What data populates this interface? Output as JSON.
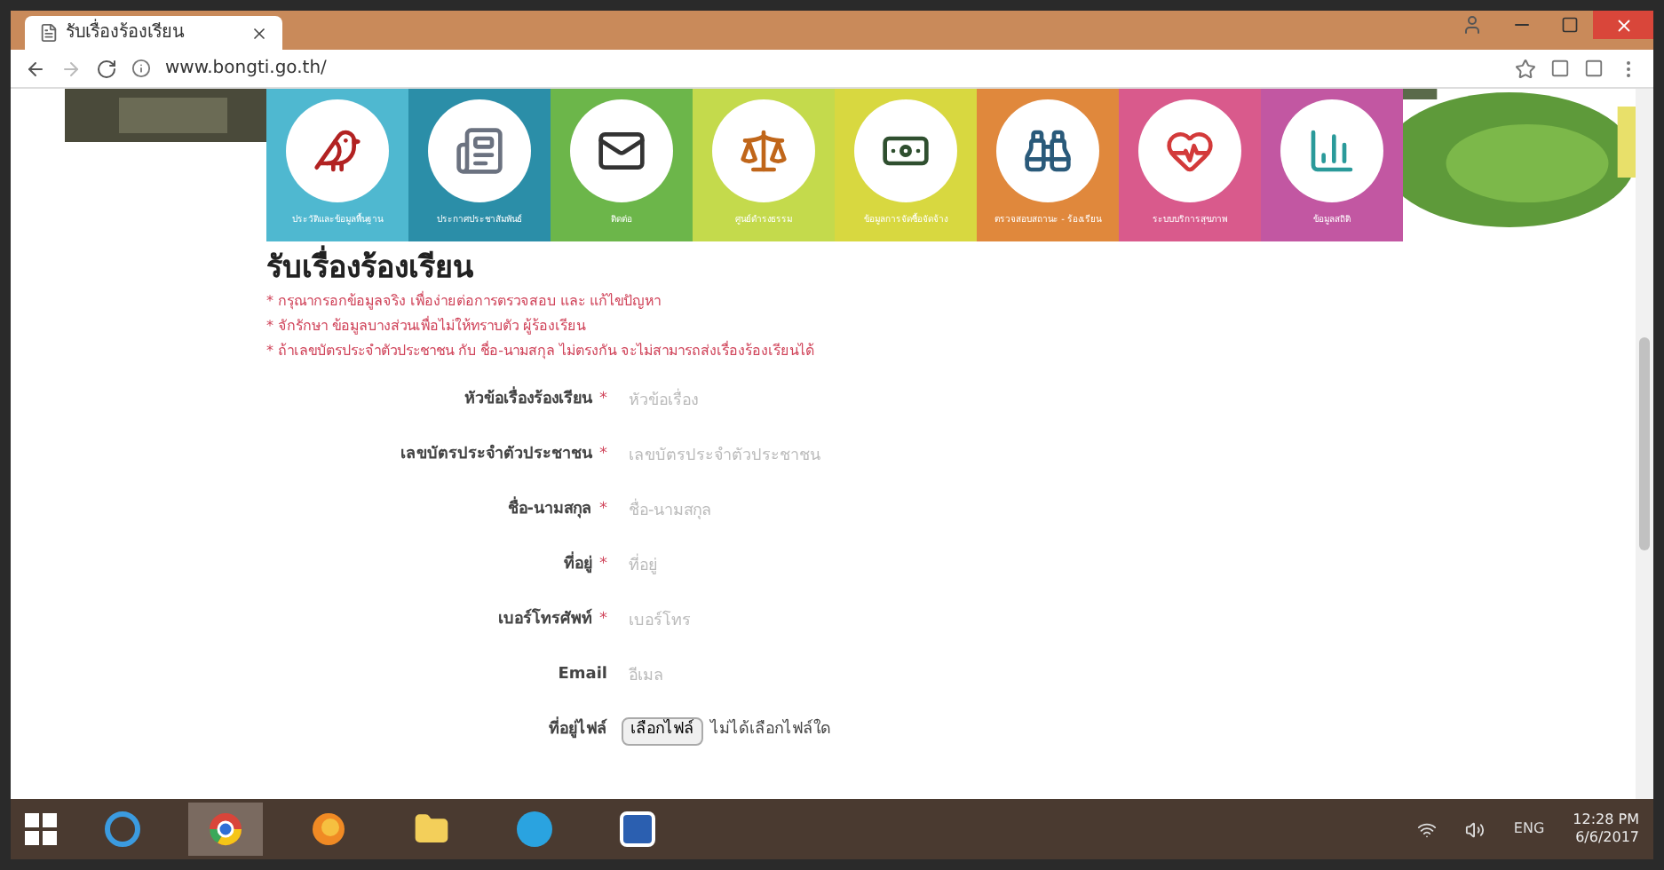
{
  "browser": {
    "tab_title": "รับเรื่องร้องเรียน",
    "url": "www.bongti.go.th/"
  },
  "tiles": [
    {
      "label": "ประวัติและข้อมูลพื้นฐาน",
      "color": "#4fb8d0",
      "kind": "emblem"
    },
    {
      "label": "ประกาศประชาสัมพันธ์",
      "color": "#2b8ea8",
      "kind": "news"
    },
    {
      "label": "ติดต่อ",
      "color": "#6cb64a",
      "kind": "mail"
    },
    {
      "label": "ศูนย์ดำรงธรรม",
      "color": "#c4da4c",
      "kind": "scales"
    },
    {
      "label": "ข้อมูลการจัดซื้อจัดจ้าง",
      "color": "#d8d840",
      "kind": "money"
    },
    {
      "label": "ตรวจสอบสถานะ - ร้องเรียน",
      "color": "#e0883c",
      "kind": "binoculars"
    },
    {
      "label": "ระบบบริการสุขภาพ",
      "color": "#d95a8c",
      "kind": "heart"
    },
    {
      "label": "ข้อมูลสถิติ",
      "color": "#c257a2",
      "kind": "chart"
    }
  ],
  "heading": "รับเรื่องร้องเรียน",
  "notes": [
    "* กรุณากรอกข้อมูลจริง เพื่อง่ายต่อการตรวจสอบ และ แก้ไขปัญหา",
    "* จักรักษา ข้อมูลบางส่วนเพื่อไม่ให้ทราบตัว ผู้ร้องเรียน",
    "* ถ้าเลขบัตรประจำตัวประชาชน กับ ชื่อ-นามสกุล ไม่ตรงกัน จะไม่สามารถส่งเรื่องร้องเรียนได้"
  ],
  "form": [
    {
      "kind": "text",
      "label": "หัวข้อเรื่องร้องเรียน",
      "required_mark": "*",
      "placeholder": "หัวข้อเรื่อง"
    },
    {
      "kind": "text",
      "label": "เลขบัตรประจำตัวประชาชน",
      "required_mark": "*",
      "placeholder": "เลขบัตรประจำตัวประชาชน"
    },
    {
      "kind": "text",
      "label": "ชื่อ-นามสกุล",
      "required_mark": "*",
      "placeholder": "ชื่อ-นามสกุล"
    },
    {
      "kind": "text",
      "label": "ที่อยู่",
      "required_mark": "*",
      "placeholder": "ที่อยู่"
    },
    {
      "kind": "text",
      "label": "เบอร์โทรศัพท์",
      "required_mark": "*",
      "placeholder": "เบอร์โทร"
    },
    {
      "kind": "text",
      "label": "Email",
      "placeholder": "อีเมล"
    },
    {
      "kind": "file",
      "label": "ที่อยู่ไฟล์",
      "button": "เลือกไฟล์",
      "value": "ไม่ได้เลือกไฟล์ใด"
    }
  ],
  "taskbar": {
    "apps": [
      {
        "kind": "ie",
        "selected": false
      },
      {
        "kind": "chrome",
        "selected": true
      },
      {
        "kind": "firefox",
        "selected": false
      },
      {
        "kind": "folder",
        "selected": false
      },
      {
        "kind": "skype",
        "selected": false
      },
      {
        "kind": "word",
        "selected": false
      }
    ],
    "language": "ENG",
    "time": "12:28 PM",
    "date": "6/6/2017"
  }
}
